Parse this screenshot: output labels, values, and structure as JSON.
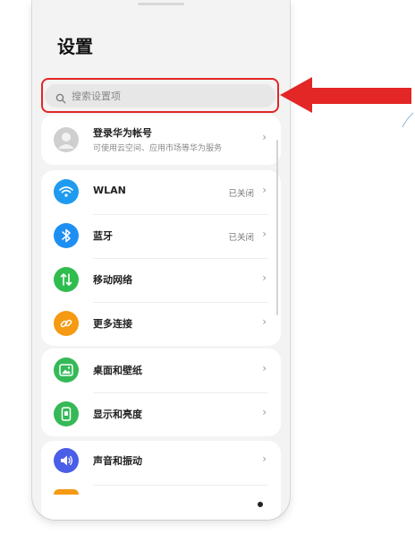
{
  "page": {
    "title": "设置"
  },
  "search": {
    "placeholder": "搜索设置项"
  },
  "account": {
    "title": "登录华为帐号",
    "subtitle": "可使用云空间、应用市场等华为服务"
  },
  "group1": [
    {
      "label": "WLAN",
      "value": "已关闭",
      "icon": "wifi-icon",
      "color": "#1e9bf0"
    },
    {
      "label": "蓝牙",
      "value": "已关闭",
      "icon": "bluetooth-icon",
      "color": "#1e8ff2"
    },
    {
      "label": "移动网络",
      "value": "",
      "icon": "mobile-network-icon",
      "color": "#2fbd4f"
    },
    {
      "label": "更多连接",
      "value": "",
      "icon": "link-icon",
      "color": "#f59a12"
    }
  ],
  "group2": [
    {
      "label": "桌面和壁纸",
      "icon": "wallpaper-icon",
      "color": "#35b957"
    },
    {
      "label": "显示和亮度",
      "icon": "display-icon",
      "color": "#35b957"
    }
  ],
  "group3": [
    {
      "label": "声音和振动",
      "icon": "sound-icon",
      "color": "#4b5ee8"
    }
  ],
  "colors": {
    "highlight": "#e32626",
    "background": "#f3f3f3",
    "card": "#ffffff"
  }
}
